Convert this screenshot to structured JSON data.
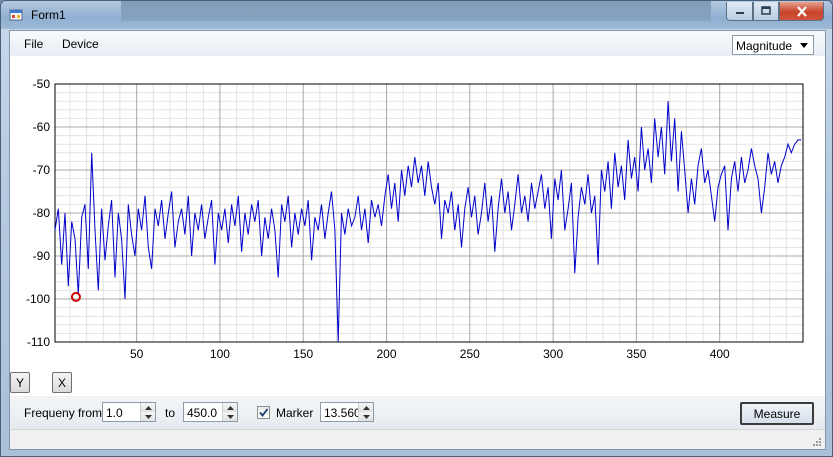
{
  "window": {
    "title": "Form1"
  },
  "menu": {
    "items": [
      "File",
      "Device"
    ]
  },
  "view_select": {
    "value": "Magnitude"
  },
  "axis_buttons": {
    "y_label": "Y",
    "x_label": "X"
  },
  "controls": {
    "freq_from_label": "Frequeny from",
    "freq_from_value": "1.0",
    "to_label": "to",
    "freq_to_value": "450.0",
    "marker_label": "Marker",
    "marker_checked": true,
    "marker_value": "13.560",
    "measure_label": "Measure"
  },
  "colors": {
    "series": "#0000cc",
    "marker": "#cc0000",
    "grid": "#c8c8c8"
  },
  "chart_data": {
    "type": "line",
    "xlim": [
      1,
      450
    ],
    "ylim": [
      -110,
      -50
    ],
    "x_ticks": [
      50,
      100,
      150,
      200,
      250,
      300,
      350,
      400
    ],
    "y_ticks": [
      -50,
      -60,
      -70,
      -80,
      -90,
      -100,
      -110
    ],
    "grid": true,
    "marker": {
      "x": 13.56,
      "y": -99.5
    },
    "series": [
      {
        "x": [
          1,
          3,
          5,
          7,
          9,
          11,
          13,
          15,
          17,
          19,
          21,
          23,
          25,
          27,
          29,
          31,
          33,
          35,
          37,
          39,
          41,
          43,
          45,
          47,
          49,
          51,
          53,
          55,
          57,
          59,
          61,
          63,
          65,
          67,
          69,
          71,
          73,
          75,
          77,
          79,
          81,
          83,
          85,
          87,
          89,
          91,
          93,
          95,
          97,
          99,
          101,
          103,
          105,
          107,
          109,
          111,
          113,
          115,
          117,
          119,
          121,
          123,
          125,
          127,
          129,
          131,
          133,
          135,
          137,
          139,
          141,
          143,
          145,
          147,
          149,
          151,
          153,
          155,
          157,
          159,
          161,
          163,
          165,
          167,
          169,
          171,
          173,
          175,
          177,
          179,
          181,
          183,
          185,
          187,
          189,
          191,
          193,
          195,
          197,
          199,
          201,
          203,
          205,
          207,
          209,
          211,
          213,
          215,
          217,
          219,
          221,
          223,
          225,
          227,
          229,
          231,
          233,
          235,
          237,
          239,
          241,
          243,
          245,
          247,
          249,
          251,
          253,
          255,
          257,
          259,
          261,
          263,
          265,
          267,
          269,
          271,
          273,
          275,
          277,
          279,
          281,
          283,
          285,
          287,
          289,
          291,
          293,
          295,
          297,
          299,
          301,
          303,
          305,
          307,
          309,
          311,
          313,
          315,
          317,
          319,
          321,
          323,
          325,
          327,
          329,
          331,
          333,
          335,
          337,
          339,
          341,
          343,
          345,
          347,
          349,
          351,
          353,
          355,
          357,
          359,
          361,
          363,
          365,
          367,
          369,
          371,
          373,
          375,
          377,
          379,
          381,
          383,
          385,
          387,
          389,
          391,
          393,
          395,
          397,
          399,
          401,
          403,
          405,
          407,
          409,
          411,
          413,
          415,
          417,
          419,
          421,
          423,
          425,
          427,
          429,
          431,
          433,
          435,
          437,
          439,
          441,
          443,
          445,
          447,
          449
        ],
        "values": [
          -84,
          -79,
          -92,
          -80,
          -97,
          -82,
          -86,
          -99,
          -81,
          -78,
          -93,
          -66,
          -84,
          -98,
          -79,
          -91,
          -83,
          -77,
          -95,
          -80,
          -86,
          -100,
          -78,
          -85,
          -90,
          -79,
          -84,
          -76,
          -88,
          -93,
          -79,
          -83,
          -77,
          -86,
          -80,
          -75,
          -88,
          -82,
          -79,
          -85,
          -76,
          -90,
          -80,
          -84,
          -78,
          -86,
          -81,
          -77,
          -92,
          -80,
          -84,
          -79,
          -87,
          -78,
          -83,
          -76,
          -89,
          -80,
          -85,
          -78,
          -82,
          -77,
          -90,
          -81,
          -86,
          -79,
          -84,
          -95,
          -78,
          -82,
          -76,
          -88,
          -80,
          -85,
          -79,
          -83,
          -77,
          -91,
          -81,
          -84,
          -78,
          -86,
          -80,
          -75,
          -84,
          -110,
          -80,
          -85,
          -79,
          -83,
          -81,
          -76,
          -84,
          -79,
          -87,
          -77,
          -81,
          -78,
          -83,
          -76,
          -71,
          -79,
          -73,
          -82,
          -70,
          -76,
          -69,
          -74,
          -67,
          -73,
          -69,
          -76,
          -68,
          -74,
          -78,
          -73,
          -86,
          -77,
          -80,
          -75,
          -84,
          -78,
          -88,
          -79,
          -74,
          -81,
          -76,
          -85,
          -80,
          -73,
          -82,
          -76,
          -89,
          -79,
          -72,
          -80,
          -75,
          -84,
          -78,
          -71,
          -80,
          -76,
          -82,
          -73,
          -79,
          -75,
          -71,
          -79,
          -74,
          -86,
          -72,
          -77,
          -70,
          -84,
          -79,
          -73,
          -94,
          -81,
          -74,
          -78,
          -71,
          -80,
          -76,
          -92,
          -70,
          -75,
          -68,
          -79,
          -66,
          -74,
          -69,
          -77,
          -63,
          -72,
          -67,
          -75,
          -60,
          -70,
          -65,
          -73,
          -58,
          -67,
          -60,
          -71,
          -54,
          -68,
          -58,
          -75,
          -61,
          -70,
          -80,
          -72,
          -78,
          -69,
          -65,
          -73,
          -70,
          -76,
          -82,
          -74,
          -71,
          -69,
          -84,
          -72,
          -68,
          -75,
          -67,
          -73,
          -70,
          -65,
          -69,
          -72,
          -80,
          -74,
          -66,
          -71,
          -68,
          -73,
          -69,
          -67,
          -64,
          -66,
          -64,
          -63,
          -63
        ]
      }
    ]
  }
}
